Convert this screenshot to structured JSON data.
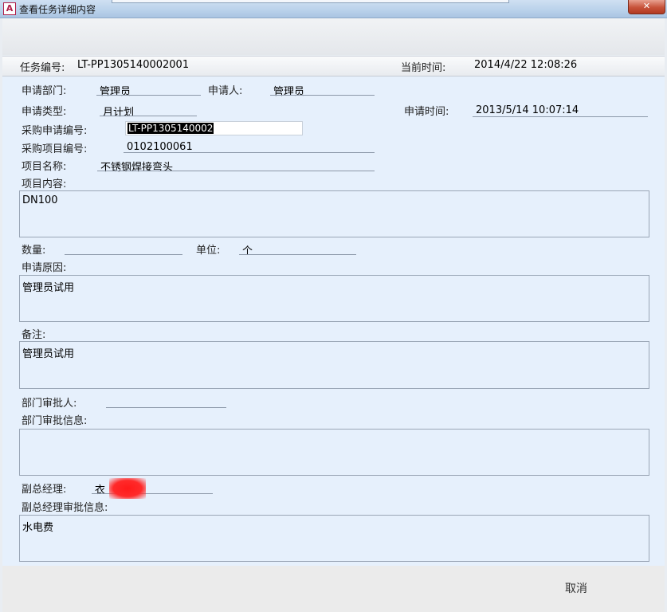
{
  "window": {
    "icon_letter": "A",
    "title": "查看任务详细内容",
    "close_symbol": "✕"
  },
  "header": {
    "task_no_label": "任务编号:",
    "task_no_value": "LT-PP1305140002001",
    "current_time_label": "当前时间:",
    "current_time_value": "2014/4/22 12:08:26"
  },
  "form": {
    "dept_label": "申请部门:",
    "dept_value": "管理员",
    "applicant_label": "申请人:",
    "applicant_value": "管理员",
    "type_label": "申请类型:",
    "type_value": "月计划",
    "apply_time_label": "申请时间:",
    "apply_time_value": "2013/5/14 10:07:14",
    "purchase_no_label": "采购申请编号:",
    "purchase_no_value": "LT-PP1305140002",
    "item_no_label": "采购项目编号:",
    "item_no_value": "0102100061",
    "item_name_label": "项目名称:",
    "item_name_value": "不锈钢焊接弯头",
    "item_content_label": "项目内容:",
    "item_content_value": "DN100",
    "qty_label": "数量:",
    "qty_value": "",
    "unit_label": "单位:",
    "unit_value": "个",
    "reason_label": "申请原因:",
    "reason_value": "管理员试用",
    "remark_label": "备注:",
    "remark_value": "管理员试用",
    "dept_approver_label": "部门审批人:",
    "dept_approver_value": "",
    "dept_approval_info_label": "部门审批信息:",
    "dept_approval_info_value": "",
    "vp_label": "副总经理:",
    "vp_value": "衣",
    "vp_approval_info_label": "副总经理审批信息:",
    "vp_approval_info_value": "水电费"
  },
  "footer": {
    "cancel_label": "取消"
  }
}
